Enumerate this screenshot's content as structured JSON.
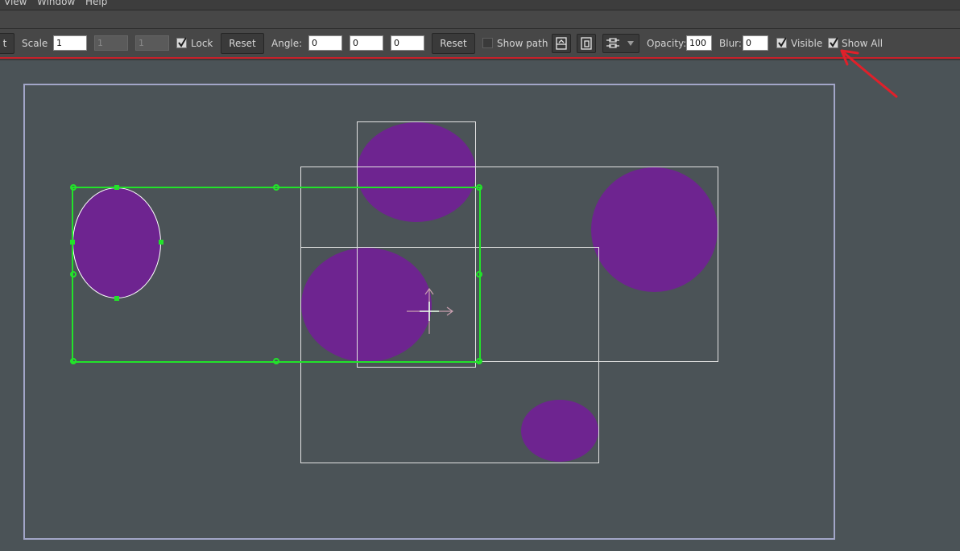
{
  "menu": {
    "items": [
      "View",
      "Window",
      "Help"
    ]
  },
  "toolbar": {
    "scale_label": "Scale",
    "scale_value": "1",
    "scale_y": "1",
    "scale_z": "1",
    "lock_label": "Lock",
    "lock_checked": true,
    "reset_label": "Reset",
    "angle_label": "Angle:",
    "angle_x": "0",
    "angle_y": "0",
    "angle_z": "0",
    "reset2_label": "Reset",
    "show_path_label": "Show path",
    "show_path_checked": false,
    "opacity_label": "Opacity:",
    "opacity_value": "100",
    "blur_label": "Blur:",
    "blur_value": "0",
    "visible_label": "Visible",
    "visible_checked": true,
    "show_all_label": "Show All",
    "show_all_checked": true,
    "icons": [
      "page-up-icon",
      "page-layer-icon",
      "align-dropdown-icon"
    ]
  },
  "colors": {
    "background": "#4b5357",
    "shape_fill": "#6e2490",
    "selection": "#22e32a",
    "canvas_border": "#a2a6c8",
    "annotation": "#e0202a"
  },
  "canvas": {
    "objects": [
      "selected-ellipse",
      "top-circle",
      "middle-circle",
      "right-circle",
      "bottom-ellipse"
    ]
  }
}
